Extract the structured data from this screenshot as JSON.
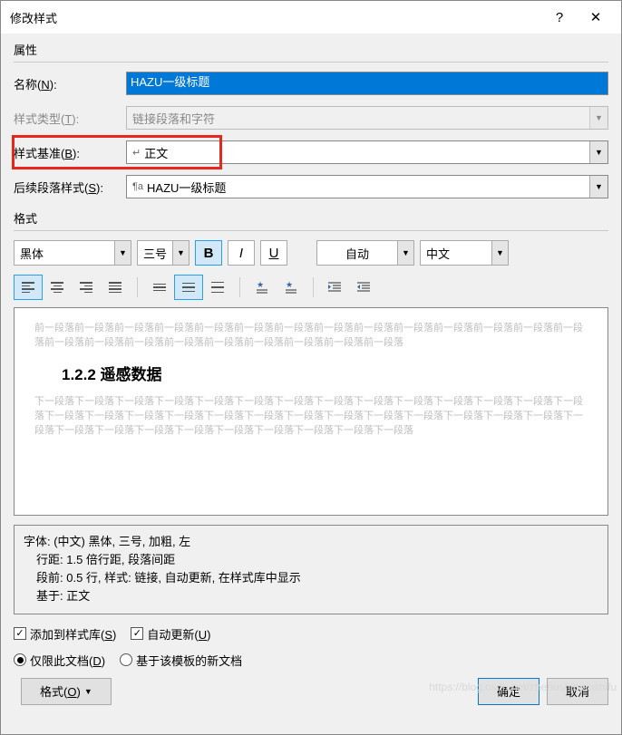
{
  "titlebar": {
    "title": "修改样式",
    "help": "?",
    "close": "✕"
  },
  "properties": {
    "section_label": "属性",
    "name": {
      "label": "名称(N):",
      "value": "HAZU一级标题"
    },
    "style_type": {
      "label": "样式类型(T):",
      "value": "链接段落和字符"
    },
    "based_on": {
      "label": "样式基准(B):",
      "value": "正文"
    },
    "following": {
      "label": "后续段落样式(S):",
      "value": "HAZU一级标题"
    }
  },
  "format": {
    "section_label": "格式",
    "font": "黑体",
    "size": "三号",
    "color": "自动",
    "lang": "中文"
  },
  "preview": {
    "before": "前一段落前一段落前一段落前一段落前一段落前一段落前一段落前一段落前一段落前一段落前一段落前一段落前一段落前一段落前一段落前一段落前一段落前一段落前一段落前一段落前一段落前一段落前一段落",
    "heading": "1.2.2 遥感数据",
    "after": "下一段落下一段落下一段落下一段落下一段落下一段落下一段落下一段落下一段落下一段落下一段落下一段落下一段落下一段落下一段落下一段落下一段落下一段落下一段落下一段落下一段落下一段落下一段落下一段落下一段落下一段落下一段落下一段落下一段落下一段落下一段落下一段落下一段落下一段落下一段落下一段落下一段落"
  },
  "summary": {
    "line1": "字体: (中文) 黑体, 三号, 加粗, 左",
    "line2": "行距: 1.5 倍行距, 段落间距",
    "line3": "段前: 0.5 行, 样式: 链接, 自动更新, 在样式库中显示",
    "line4": "基于: 正文"
  },
  "checks": {
    "add_gallery": "添加到样式库(S)",
    "auto_update": "自动更新(U)",
    "only_doc": "仅限此文档(D)",
    "new_template": "基于该模板的新文档"
  },
  "footer": {
    "format_menu": "格式(O)",
    "ok": "确定",
    "cancel": "取消"
  },
  "watermark": "https://blog.csdn.net/zhebushibiaoshifu"
}
